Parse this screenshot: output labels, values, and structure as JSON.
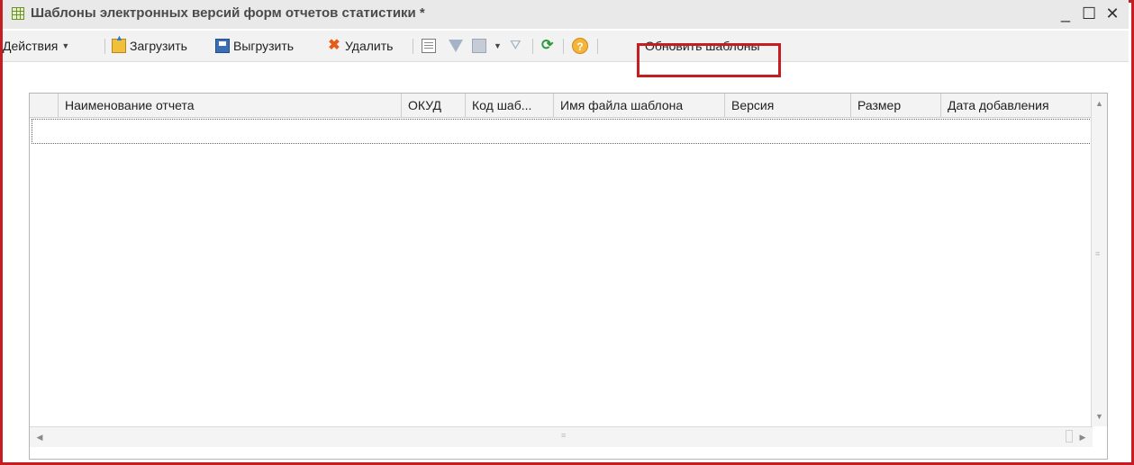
{
  "window": {
    "title": "Шаблоны электронных версий форм отчетов статистики *",
    "minimize": "_",
    "maximize": "☐",
    "close": "✕"
  },
  "toolbar": {
    "actions_label": "Действия",
    "load_label": "Загрузить",
    "unload_label": "Выгрузить",
    "delete_label": "Удалить",
    "help_symbol": "?",
    "update_templates_label": "Обновить шаблоны"
  },
  "table": {
    "columns": [
      "Наименование отчета",
      "ОКУД",
      "Код шаб...",
      "Имя файла шаблона",
      "Версия",
      "Размер",
      "Дата добавления"
    ],
    "rows": []
  },
  "colors": {
    "highlight": "#c41e22",
    "refresh": "#2f9a3a",
    "delete": "#e85a1a"
  }
}
